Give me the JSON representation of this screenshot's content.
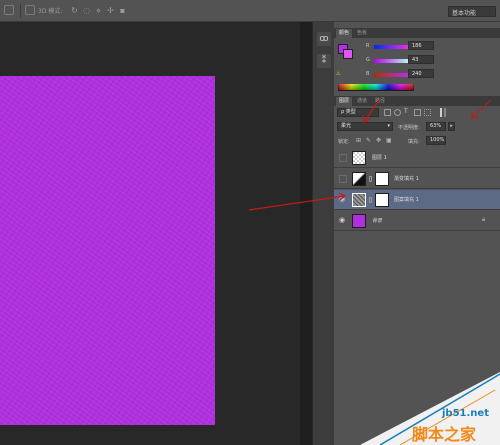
{
  "options_bar": {
    "mode3d_label": "3D 模式:",
    "workspace": "基本功能"
  },
  "color_panel": {
    "tabs": [
      "颜色",
      "色板"
    ],
    "channels": [
      {
        "label": "R",
        "value": "186"
      },
      {
        "label": "G",
        "value": "43"
      },
      {
        "label": "B",
        "value": "240"
      }
    ],
    "foreground_color": "#ba2bf0",
    "background_color": "#e055f5"
  },
  "layers_panel": {
    "tabs": [
      "图层",
      "通道",
      "路径"
    ],
    "filter_type": "类型",
    "blend_mode": "柔光",
    "opacity_label": "不透明度:",
    "opacity_value": "63%",
    "lock_label": "锁定:",
    "fill_label": "填充:",
    "fill_value": "100%",
    "layers": [
      {
        "name": "图层 1",
        "visible": false,
        "selected": false
      },
      {
        "name": "渐变填充 1",
        "visible": false,
        "selected": false
      },
      {
        "name": "图案填充 1",
        "visible": true,
        "selected": true
      },
      {
        "name": "背景",
        "visible": true,
        "selected": false
      }
    ]
  },
  "canvas": {
    "fill_color": "#b030e0"
  },
  "watermark": {
    "url": "jb51.net",
    "name": "脚本之家"
  }
}
